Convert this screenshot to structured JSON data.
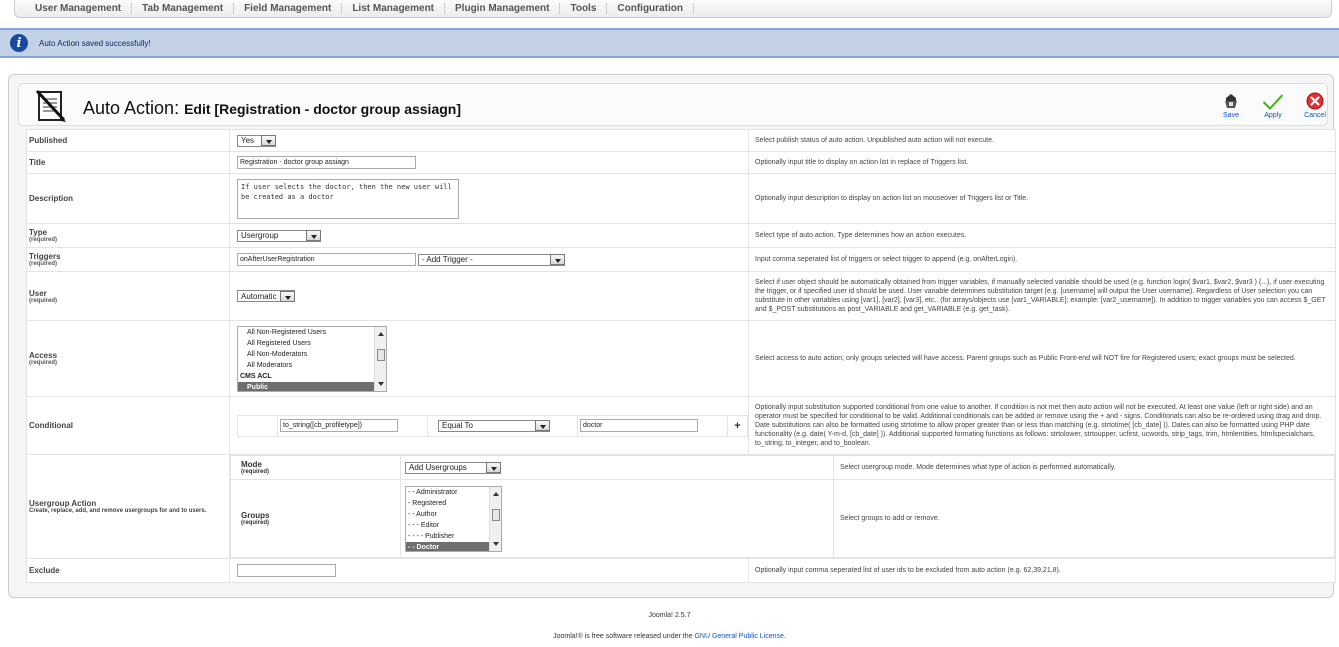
{
  "menu": [
    "User Management",
    "Tab Management",
    "Field Management",
    "List Management",
    "Plugin Management",
    "Tools",
    "Configuration"
  ],
  "message": "Auto Action saved successfully!",
  "header": {
    "title": "Auto Action:",
    "subtitle": "Edit [Registration - doctor group assiagn]"
  },
  "toolbar": {
    "save": "Save",
    "apply": "Apply",
    "cancel": "Cancel"
  },
  "required": "(required)",
  "fields": {
    "published": {
      "label": "Published",
      "value": "Yes",
      "desc": "Select publish status of auto action. Unpublished auto action will not execute."
    },
    "title": {
      "label": "Title",
      "value": "Registration - doctor group assiagn",
      "desc": "Optionally input title to display on action list in replace of Triggers list."
    },
    "description": {
      "label": "Description",
      "value": "If user selects the doctor, then the new user will be created as a doctor",
      "desc": "Optionally input description to display on action list on mouseover of Triggers list or Title."
    },
    "type": {
      "label": "Type",
      "value": "Usergroup",
      "desc": "Select type of auto action. Type determines how an action executes."
    },
    "triggers": {
      "label": "Triggers",
      "value": "onAfterUserRegistration",
      "add": "- Add Trigger -",
      "desc": "Input comma seperated list of triggers or select trigger to append (e.g. onAfterLogin)."
    },
    "user": {
      "label": "User",
      "value": "Automatic",
      "desc": "Select if user object should be automatically obtained from trigger variables, if manually selected variable should be used (e.g. function login( $var1, $var2, $var3 ) {...}, if user executing the trigger, or if specified user id should be used. User variable determines substitution target (e.g. [username] will output the User username). Regardless of User selection you can substitute in other variables using [var1], [var2], [var3], etc.. (for arrays/objects use [var1_VARIABLE]; example: [var2_username]). In addition to trigger variables you can access $_GET and $_POST substitutions as post_VARIABLE and get_VARIABLE (e.g. get_task)."
    },
    "access": {
      "label": "Access",
      "options": [
        "All Non-Registered Users",
        "All Registered Users",
        "All Non-Moderators",
        "All Moderators"
      ],
      "group": "CMS ACL",
      "selected": "Public",
      "desc": "Select access to auto action; only groups selected will have access. Parent groups such as Public Front-end will NOT fire for Registered users; exact groups must be selected."
    },
    "conditional": {
      "label": "Conditional",
      "left": "to_string([cb_profiletype])",
      "operator": "Equal To",
      "right": "doctor",
      "add": "+",
      "desc": "Optionally input substitution supported conditional from one value to another. If condition is not met then auto action will not be executed. At least one value (left or right side) and an operator must be specified for conditional to be valid. Additional conditionals can be added or remove using the + and - signs. Conditionals can also be re-ordered using drag and drop. Date substitutions can also be formatted using strtotime to allow proper greater than or less than matching (e.g. strtotime( [cb_date] )). Dates can also be formatted using PHP date functionality (e.g. date( Y-m-d, [cb_date] )). Additional supported formating functions as follows: strtolower, strtoupper, ucfirst, ucwords, strip_tags, trim, htmlentities, htmlspecialchars, to_string, to_integer, and to_boolean."
    },
    "usergroup": {
      "label": "Usergroup Action",
      "note": "Create, replace, add, and remove usergroups for and to users.",
      "mode_label": "Mode",
      "mode_value": "Add Usergroups",
      "mode_desc": "Select usergroup mode. Mode determines what type of action is performed automatically.",
      "groups_label": "Groups",
      "groups": [
        "- - Administrator",
        "- Registered",
        "- - Author",
        "- - - Editor",
        "- - - - Publisher"
      ],
      "groups_selected": "- - Doctor",
      "groups_desc": "Select groups to add or remove."
    },
    "exclude": {
      "label": "Exclude",
      "value": "",
      "desc": "Optionally input comma seperated list of user ids to be excluded from auto action (e.g. 62,39,21,8)."
    }
  },
  "footer": {
    "version": "Joomla! 2.5.7",
    "lic_pre": "Joomla!® is free software released under the ",
    "lic_link": "GNU General Public License",
    "lic_post": "."
  }
}
